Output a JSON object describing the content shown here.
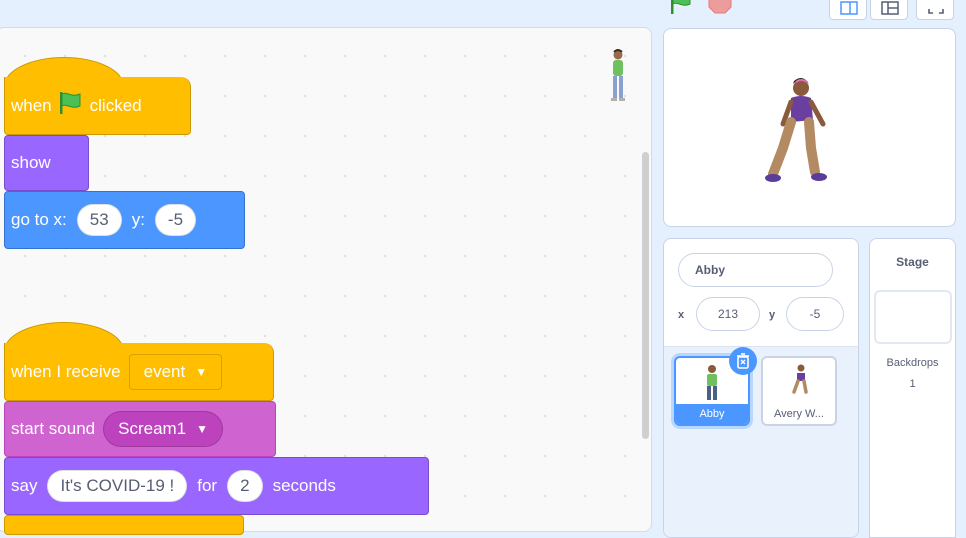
{
  "icons": {
    "green_flag": "green-flag-icon",
    "stop": "stop-sign-icon",
    "small_stage": "small-stage-icon",
    "large_stage": "large-stage-icon",
    "fullscreen": "fullscreen-icon",
    "delete": "trash-icon"
  },
  "colors": {
    "events": "#ffbf00",
    "looks": "#9966ff",
    "motion": "#4c97ff",
    "sound": "#cf63cf",
    "accent": "#855cd6"
  },
  "scripts": [
    {
      "hat": {
        "when": "when",
        "clicked": "clicked"
      },
      "show": "show",
      "goto": {
        "label": "go to x:",
        "x": "53",
        "y_label": "y:",
        "y": "-5"
      }
    },
    {
      "hat": {
        "when_receive": "when I receive",
        "message": "event"
      },
      "sound": {
        "label": "start sound",
        "value": "Scream1"
      },
      "say": {
        "label": "say",
        "text": "It's COVID-19 !",
        "for": "for",
        "secs": "2",
        "seconds": "seconds"
      }
    }
  ],
  "sprite_info": {
    "name": "Abby",
    "x_label": "x",
    "x": "213",
    "y_label": "y",
    "y": "-5"
  },
  "sprites": [
    {
      "name": "Abby",
      "selected": true
    },
    {
      "name": "Avery W...",
      "selected": false
    }
  ],
  "stage_pane": {
    "title": "Stage",
    "backdrops_label": "Backdrops",
    "backdrops_count": "1"
  }
}
